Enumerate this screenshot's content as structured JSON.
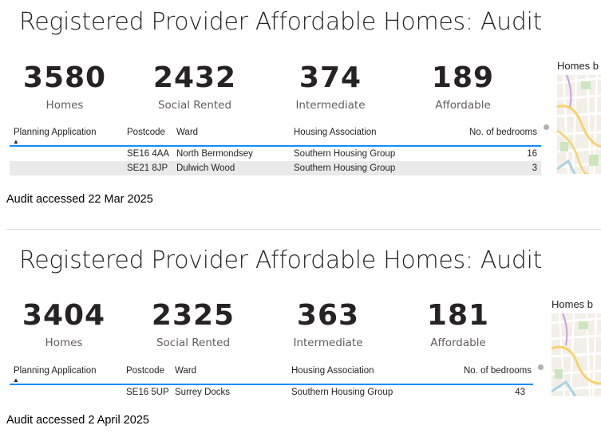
{
  "panels": [
    {
      "title": "Registered Provider Affordable Homes: Audit",
      "kpis": [
        {
          "value": "3580",
          "label": "Homes"
        },
        {
          "value": "2432",
          "label": "Social Rented"
        },
        {
          "value": "374",
          "label": "Intermediate"
        },
        {
          "value": "189",
          "label": "Affordable"
        }
      ],
      "table": {
        "headers": [
          "Planning Application",
          "Postcode",
          "Ward",
          "Housing Association",
          "No. of bedrooms"
        ],
        "rows": [
          {
            "planning_application": "",
            "postcode": "SE16 4AA",
            "ward": "North Bermondsey",
            "housing_association": "Southern Housing Group",
            "bedrooms": "16"
          },
          {
            "planning_application": "",
            "postcode": "SE21 8JP",
            "ward": "Dulwich Wood",
            "housing_association": "Southern Housing Group",
            "bedrooms": "3"
          }
        ]
      },
      "map_title": "Homes b",
      "audit_note": "Audit accessed 22 Mar 2025"
    },
    {
      "title": "Registered Provider Affordable Homes: Audit",
      "kpis": [
        {
          "value": "3404",
          "label": "Homes"
        },
        {
          "value": "2325",
          "label": "Social Rented"
        },
        {
          "value": "363",
          "label": "Intermediate"
        },
        {
          "value": "181",
          "label": "Affordable"
        }
      ],
      "table": {
        "headers": [
          "Planning Application",
          "Postcode",
          "Ward",
          "Housing Association",
          "No. of bedrooms"
        ],
        "rows": [
          {
            "planning_application": "",
            "postcode": "SE16 5UP",
            "ward": "Surrey Docks",
            "housing_association": "Southern Housing Group",
            "bedrooms": "43"
          }
        ]
      },
      "map_title": "Homes b",
      "audit_note": "Audit accessed 2 April 2025"
    }
  ],
  "colors": {
    "header_rule": "#118dff",
    "alt_row": "#eaeaea",
    "kpi_label": "#605e5c"
  },
  "icons": {
    "sort": "sort-ascending-icon",
    "scroll": "scrollbar-thumb"
  }
}
